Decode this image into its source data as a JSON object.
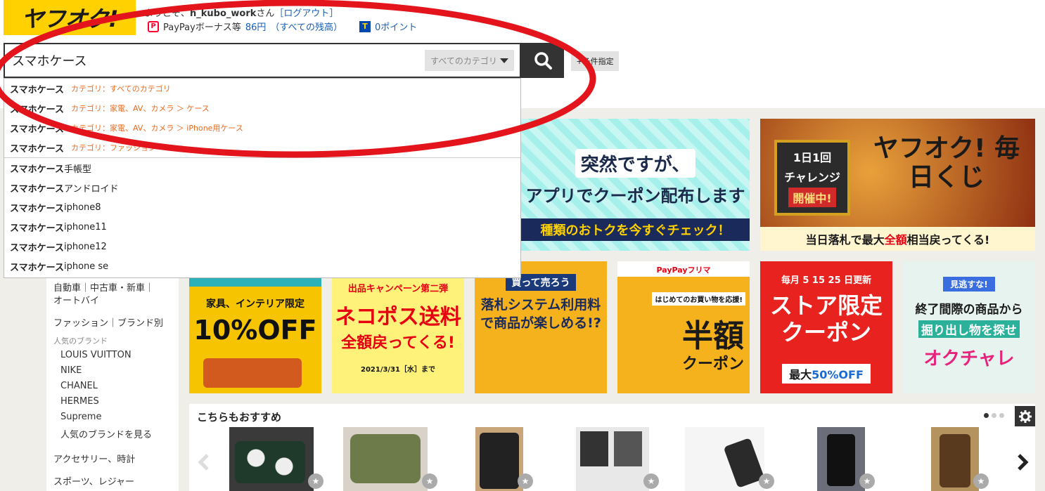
{
  "header": {
    "logo_text": "ヤフオク!",
    "greeting_prefix": "ようこそ、",
    "username": "h_kubo_work",
    "greeting_suffix": "さん",
    "logout": "［ログアウト］",
    "paypay_icon": "P",
    "paypay_label": "PayPayボーナス等",
    "paypay_amount": "86円",
    "paypay_breakdown": "（すべての残高）",
    "tpoint_icon": "T",
    "tpoint": "0ポイント"
  },
  "search": {
    "query": "スマホケース",
    "category": "すべてのカテゴリ",
    "condition_button": "+条件指定"
  },
  "suggestions": {
    "category_items": [
      {
        "keyword": "スマホケース",
        "category": "カテゴリ：すべてのカテゴリ"
      },
      {
        "keyword": "スマホケース",
        "category": "カテゴリ：家電、AV、カメラ ＞ ケース"
      },
      {
        "keyword": "スマホケース",
        "category": "カテゴリ：家電、AV、カメラ ＞ iPhone用ケース"
      },
      {
        "keyword": "スマホケース",
        "category": "カテゴリ：ファッション"
      }
    ],
    "keyword_items": [
      {
        "keyword": "スマホケース",
        "rest": " 手帳型"
      },
      {
        "keyword": "スマホケース",
        "rest": " アンドロイド"
      },
      {
        "keyword": "スマホケース",
        "rest": " iphone8"
      },
      {
        "keyword": "スマホケース",
        "rest": "iphone11"
      },
      {
        "keyword": "スマホケース",
        "rest": "iphone12"
      },
      {
        "keyword": "スマホケース",
        "rest": " iphone se"
      }
    ]
  },
  "left_nav": {
    "cars": "自動車｜中古車・新車｜",
    "bikes": "オートバイ",
    "fashion": "ファッション｜ブランド別",
    "popular_brands_heading": "人気のブランド",
    "brands": [
      "LOUIS VUITTON",
      "NIKE",
      "CHANEL",
      "HERMES",
      "Supreme",
      "人気のブランドを見る"
    ],
    "accessories": "アクセサリー、時計",
    "sports": "スポーツ、レジャー"
  },
  "banners": {
    "coupon_line1": "突然ですが、",
    "coupon_line2": "アプリでクーポン配布します",
    "coupon_strip": "種類のおトクを今すぐチェック！",
    "kuji_badge1": "1日1回",
    "kuji_badge2": "チャレンジ",
    "kuji_badge3": "開催中!",
    "kuji_title": "ヤフオク! 毎日くじ",
    "kuji_bottom_pre": "当日落札で最大",
    "kuji_bottom_red": "全額",
    "kuji_bottom_post": "相当戻ってくる!",
    "interior_label": "家具、インテリア限定",
    "interior_off": "10%OFF",
    "nekopos_head": "出品キャンペーン第二弾",
    "nekopos_l1": "ネコポス送料",
    "nekopos_l2": "全額戻ってくる!",
    "nekopos_date": "2021/3/31［水］まで",
    "sell_head": "買って売ろう",
    "sell_body": "落札システム利用料で商品が楽しめる!?",
    "paypay_flea_head": "PayPayフリマ",
    "paypay_flea_msg": "はじめてのお買い物を応援!",
    "paypay_flea_big": "半額",
    "paypay_flea_cp": "クーポン",
    "store_head": "毎月 5 15 25 日更新",
    "store_big": "ストア限定 クーポン",
    "store_off_pre": "最大",
    "store_off_num": "50%OFF",
    "okuchare_head": "見逃すな!",
    "okuchare_l1": "終了間際の商品から",
    "okuchare_l2": "掘り出し物を探せ",
    "okuchare_l3": "オクチャレ"
  },
  "recommend": {
    "title": "こちらもおすすめ",
    "star_icon": "★"
  },
  "colors": {
    "brand_yellow": "#ffd100",
    "annotation_red": "#e3141b",
    "link_blue": "#1a5fb4",
    "category_orange": "#e96b1f"
  }
}
